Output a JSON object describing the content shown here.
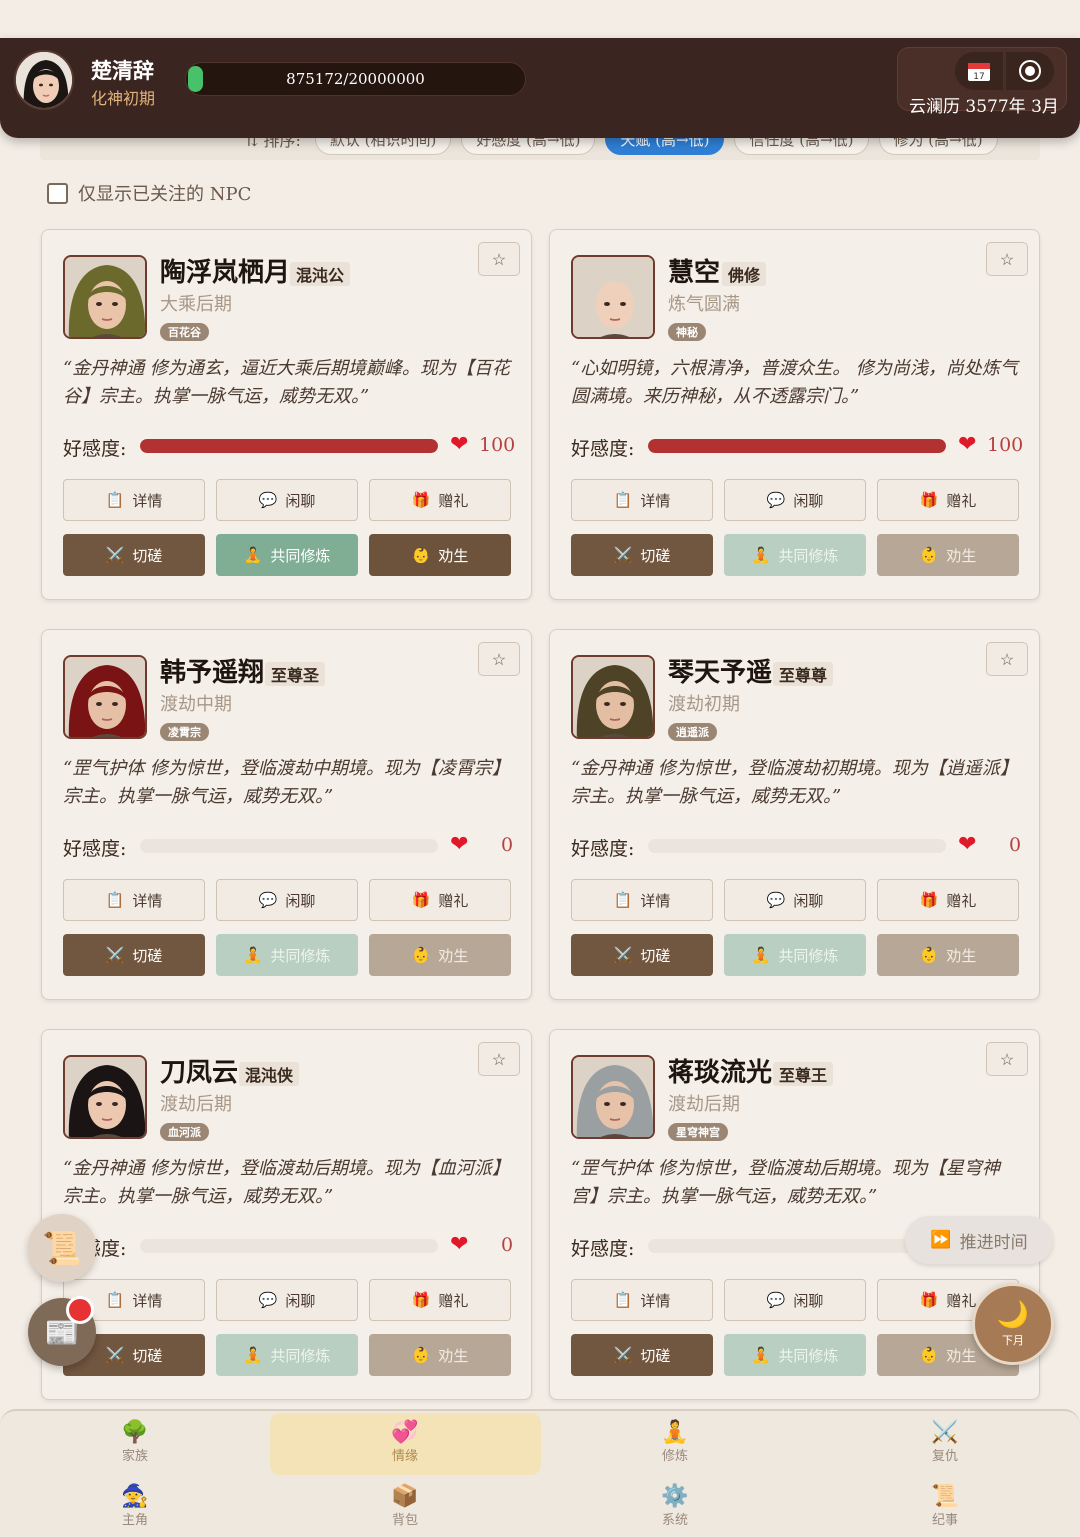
{
  "player": {
    "name": "楚清辞",
    "realm": "化神初期",
    "exp_text": "875172/20000000",
    "exp_progress": 0.044
  },
  "calendar": {
    "date": "云澜历 3577年 3月",
    "cal_icon": "calendar-icon",
    "record_icon": "record-icon"
  },
  "sort": {
    "label": "⇅ 排序:",
    "options": [
      "默认 (相识时间)",
      "好感度 (高→低)",
      "天赋 (高→低)",
      "信任度 (高→低)",
      "修为 (高→低)"
    ],
    "active": 2
  },
  "filter": {
    "label": "仅显示已关注的 NPC",
    "checked": false
  },
  "labels": {
    "affection": "好感度:",
    "detail": "详情",
    "chat": "闲聊",
    "gift": "赠礼",
    "spar": "切磋",
    "cultivate": "共同修炼",
    "persuade": "劝生",
    "star": "☆"
  },
  "npcs": [
    {
      "name": "陶浮岚栖月",
      "title": "混沌公",
      "realm": "大乘后期",
      "sect": "百花谷",
      "quote": "“金丹神通 修为通玄，逼近大乘后期境巅峰。现为【百花谷】宗主。执掌一脉气运，威势无双。”",
      "affection": "100",
      "affection_pct": 100,
      "cultivate_enabled": true,
      "persuade_enabled": true,
      "hair": "#6b6a2c",
      "skin": "#e9c4a8",
      "bald": false
    },
    {
      "name": "慧空",
      "title": "佛修",
      "realm": "炼气圆满",
      "sect": "神秘",
      "quote": "“心如明镜，六根清净，普渡众生。 修为尚浅，尚处炼气圆满境。来历神秘，从不透露宗门。”",
      "affection": "100",
      "affection_pct": 100,
      "cultivate_enabled": false,
      "persuade_enabled": false,
      "hair": "#e9c8b0",
      "skin": "#efd0ba",
      "bald": true
    },
    {
      "name": "韩予遥翔",
      "title": "至尊圣",
      "realm": "渡劫中期",
      "sect": "凌霄宗",
      "quote": "“罡气护体 修为惊世，登临渡劫中期境。现为【凌霄宗】宗主。执掌一脉气运，威势无双。”",
      "affection": "0",
      "affection_pct": 0,
      "cultivate_enabled": false,
      "persuade_enabled": false,
      "hair": "#7a1414",
      "skin": "#e6c0a6",
      "bald": false
    },
    {
      "name": "琴天予遥",
      "title": "至尊尊",
      "realm": "渡劫初期",
      "sect": "逍遥派",
      "quote": "“金丹神通 修为惊世，登临渡劫初期境。现为【逍遥派】宗主。执掌一脉气运，威势无双。”",
      "affection": "0",
      "affection_pct": 0,
      "cultivate_enabled": false,
      "persuade_enabled": false,
      "hair": "#4e4326",
      "skin": "#e4bea2",
      "bald": false
    },
    {
      "name": "刀凤云",
      "title": "混沌侠",
      "realm": "渡劫后期",
      "sect": "血河派",
      "quote": "“金丹神通 修为惊世，登临渡劫后期境。现为【血河派】宗主。执掌一脉气运，威势无双。”",
      "affection": "0",
      "affection_pct": 0,
      "cultivate_enabled": false,
      "persuade_enabled": false,
      "hair": "#1a1414",
      "skin": "#ecc8b0",
      "bald": false
    },
    {
      "name": "蒋琰流光",
      "title": "至尊王",
      "realm": "渡劫后期",
      "sect": "星穹神宫",
      "quote": "“罡气护体 修为惊世，登临渡劫后期境。现为【星穹神宫】宗主。执掌一脉气运，威势无双。”",
      "affection": "0",
      "affection_pct": 0,
      "cultivate_enabled": false,
      "persuade_enabled": false,
      "hair": "#9aa0a2",
      "skin": "#e6c2a8",
      "bald": false
    }
  ],
  "floating": {
    "advance_time": "推进时间",
    "next_month": "下月",
    "scroll_icon": "scroll-icon",
    "news_icon": "newspaper-icon",
    "moon_icon": "moon-icon"
  },
  "nav": [
    {
      "label": "家族",
      "icon": "🌳",
      "active": false
    },
    {
      "label": "情缘",
      "icon": "💞",
      "active": true
    },
    {
      "label": "修炼",
      "icon": "🧘",
      "active": false
    },
    {
      "label": "复仇",
      "icon": "⚔️",
      "active": false
    },
    {
      "label": "主角",
      "icon": "🧙",
      "active": false
    },
    {
      "label": "背包",
      "icon": "📦",
      "active": false
    },
    {
      "label": "系统",
      "icon": "⚙️",
      "active": false
    },
    {
      "label": "纪事",
      "icon": "📜",
      "active": false
    }
  ]
}
